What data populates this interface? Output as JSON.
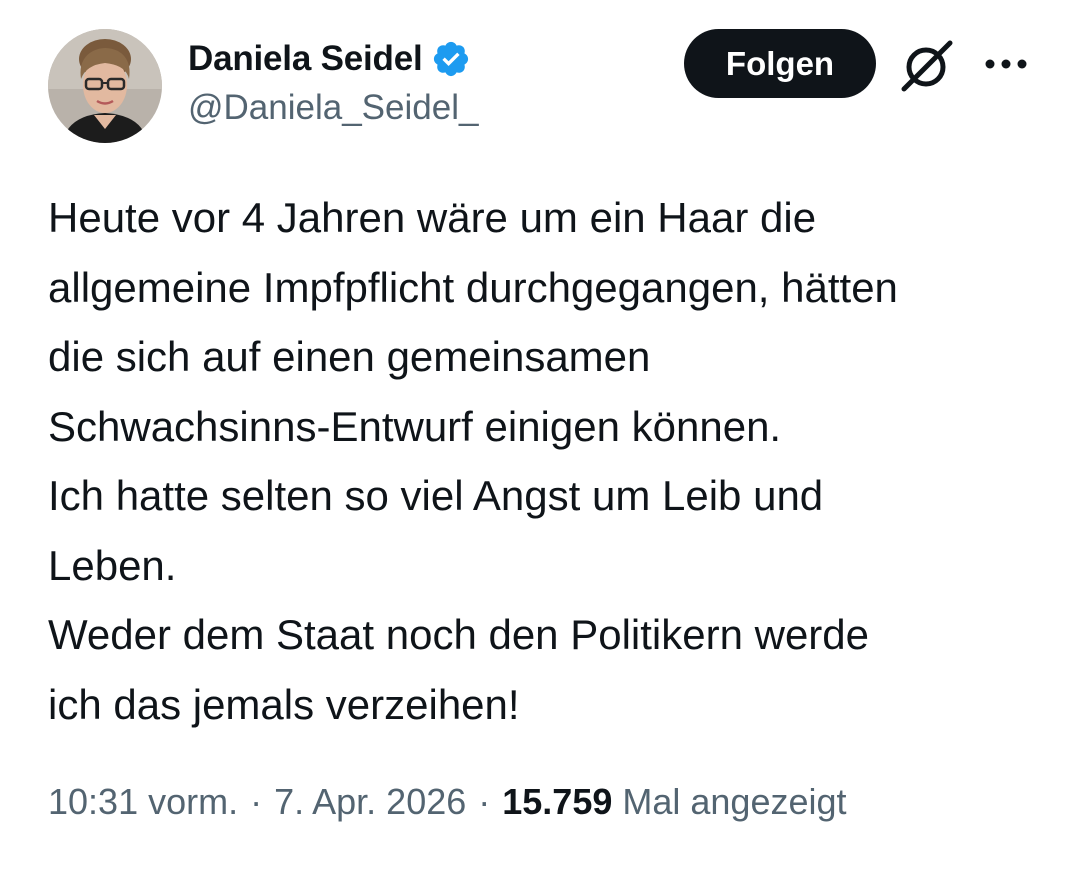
{
  "author": {
    "display_name": "Daniela Seidel",
    "handle": "@Daniela_Seidel_",
    "verified": true,
    "verified_color": "#1d9bf0"
  },
  "actions": {
    "follow_label": "Folgen",
    "grok_icon": "grok-icon",
    "more_icon": "more-horizontal-icon"
  },
  "tweet": {
    "lines": [
      "Heute vor 4 Jahren wäre um ein Haar die",
      "allgemeine Impfpflicht durchgegangen, hätten",
      "die sich auf einen gemeinsamen",
      "Schwachsinns-Entwurf einigen können.",
      "Ich hatte selten so viel Angst um Leib und",
      "Leben.",
      "Weder dem Staat noch den Politikern werde",
      "ich das jemals verzeihen!"
    ]
  },
  "meta": {
    "time": "10:31 vorm.",
    "separator": "·",
    "date": "7. Apr. 2026",
    "views_count": "15.759",
    "views_label": "Mal angezeigt"
  },
  "colors": {
    "text_primary": "#0f1419",
    "text_secondary": "#536471",
    "button_bg": "#0f1419",
    "button_text": "#ffffff"
  }
}
